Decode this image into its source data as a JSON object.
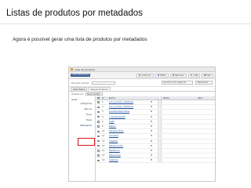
{
  "slide": {
    "title": "Listas de produtos por metadados",
    "subtitle": "Agora é possível gerar uma lista de produtos por metadados"
  },
  "app": {
    "window_title": "Lista de produtos",
    "toolbar": {
      "tag": "LISTA PRODUTOS",
      "buttons": [
        {
          "label": "Adicionar",
          "color": "#3a9a3a"
        },
        {
          "label": "Editar",
          "color": "#3b6fb6"
        },
        {
          "label": "Remover",
          "color": "#c94a3a"
        },
        {
          "label": "Lista",
          "color": "#888888"
        },
        {
          "label": "Sair",
          "color": "#888888"
        }
      ]
    },
    "search": {
      "label": "Procurar produto",
      "filter_placeholder": "Escolha uma categoria",
      "filter2_placeholder": "Metadados"
    },
    "tabs": [
      "Lista Dados",
      "Seleção Dinâmica"
    ],
    "sort": {
      "label": "Ordenar por",
      "value": "Nome Ordem"
    },
    "sidebar": {
      "header": "Geral",
      "items": [
        "Categorias",
        "Marcas",
        "Tipos",
        "Fases",
        "Metadados"
      ],
      "selected": "Metadados"
    },
    "grid": {
      "columns": {
        "id": "Id",
        "name": "Nome",
        "status": "",
        "name2": "Nome",
        "value": "Valor"
      },
      "rows": [
        {
          "id": "1",
          "name": "prm_produto_metadado",
          "status": "M"
        },
        {
          "id": "2",
          "name": "prm_produto_metadado",
          "status": "M"
        },
        {
          "id": "3",
          "name": "produtosdeprodutos",
          "status": "M"
        },
        {
          "id": "4",
          "name": "conjuntoobjetos",
          "status": "M"
        },
        {
          "id": "5",
          "name": "teste",
          "status": "M"
        },
        {
          "id": "6",
          "name": "RRD17",
          "status": "M"
        },
        {
          "id": "10",
          "name": "Alimento Tropi",
          "status": "M"
        },
        {
          "id": "11",
          "name": "Condelos",
          "status": "M"
        },
        {
          "id": "12",
          "name": "Vegetais",
          "status": "M"
        },
        {
          "id": "13",
          "name": "Rakkasminlas",
          "status": "M"
        },
        {
          "id": "14",
          "name": "Bolsatruco",
          "status": "M"
        },
        {
          "id": "15",
          "name": "Especiarias",
          "status": "M"
        },
        {
          "id": "16",
          "name": "Gastoras",
          "status": "M"
        }
      ]
    }
  }
}
